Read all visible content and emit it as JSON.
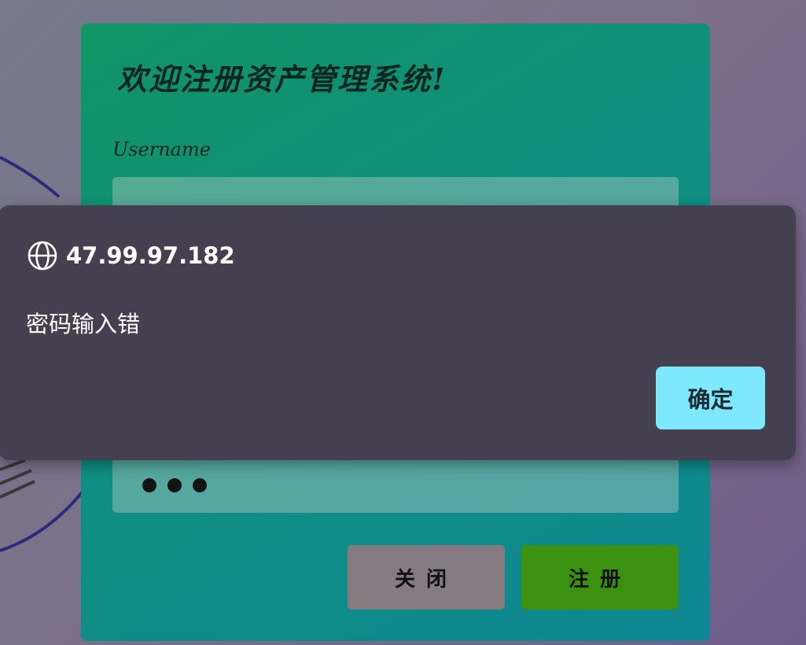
{
  "register_form": {
    "title": "欢迎注册资产管理系统!",
    "username_label": "Username",
    "username_value": "",
    "password_masked_length": 3,
    "close_button": "关闭",
    "register_button": "注册"
  },
  "alert_dialog": {
    "origin": "47.99.97.182",
    "message": "密码输入错",
    "ok_button": "确定"
  },
  "colors": {
    "card_start": "#119466",
    "card_end": "#0e8893",
    "close_button": "#857a7f",
    "register_button": "#3a9210",
    "dialog_bg": "#45404f",
    "ok_button": "#7ee9fe"
  },
  "icons": {
    "origin_icon": "globe-icon"
  }
}
